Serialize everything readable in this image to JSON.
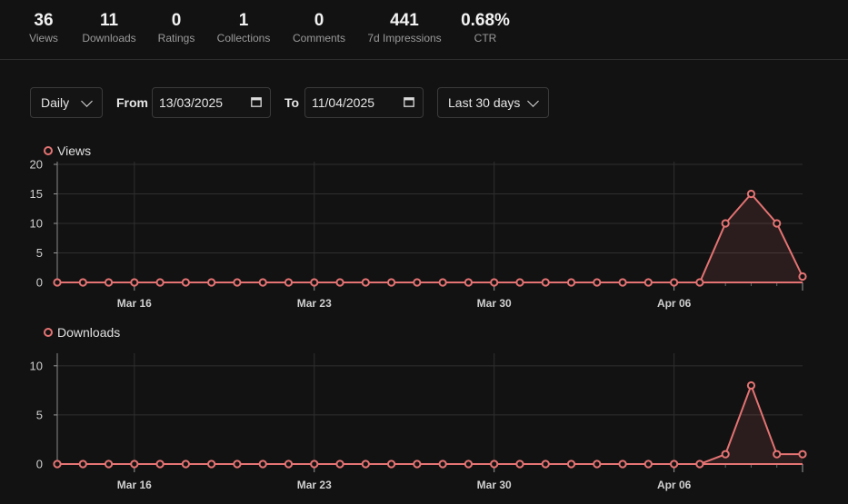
{
  "stats": [
    {
      "value": "36",
      "label": "Views"
    },
    {
      "value": "11",
      "label": "Downloads"
    },
    {
      "value": "0",
      "label": "Ratings"
    },
    {
      "value": "1",
      "label": "Collections"
    },
    {
      "value": "0",
      "label": "Comments"
    },
    {
      "value": "441",
      "label": "7d Impressions"
    },
    {
      "value": "0.68%",
      "label": "CTR"
    }
  ],
  "controls": {
    "interval": "Daily",
    "from_label": "From",
    "from_value": "13/03/2025",
    "to_label": "To",
    "to_value": "11/04/2025",
    "range": "Last 30 days"
  },
  "colors": {
    "series": "#e57373",
    "background": "#121212",
    "grid": "#2f2f2f"
  },
  "chart_data": [
    {
      "type": "area",
      "x_start": "2025-03-13",
      "x_end": "2025-04-11",
      "x_tick_labels": [
        "Mar 16",
        "Mar 23",
        "Mar 30",
        "Apr 06"
      ],
      "y_ticks": [
        0,
        5,
        10,
        15,
        20
      ],
      "ylim": [
        0,
        20
      ],
      "grid": true,
      "legend": "top-left",
      "series": [
        {
          "name": "Views",
          "values": [
            0,
            0,
            0,
            0,
            0,
            0,
            0,
            0,
            0,
            0,
            0,
            0,
            0,
            0,
            0,
            0,
            0,
            0,
            0,
            0,
            0,
            0,
            0,
            0,
            0,
            0,
            10,
            15,
            10,
            1
          ]
        }
      ]
    },
    {
      "type": "area",
      "x_start": "2025-03-13",
      "x_end": "2025-04-11",
      "x_tick_labels": [
        "Mar 16",
        "Mar 23",
        "Mar 30",
        "Apr 06"
      ],
      "y_ticks": [
        0,
        5,
        10
      ],
      "ylim": [
        0,
        11
      ],
      "grid": true,
      "legend": "top-left",
      "series": [
        {
          "name": "Downloads",
          "values": [
            0,
            0,
            0,
            0,
            0,
            0,
            0,
            0,
            0,
            0,
            0,
            0,
            0,
            0,
            0,
            0,
            0,
            0,
            0,
            0,
            0,
            0,
            0,
            0,
            0,
            0,
            1,
            8,
            1,
            1
          ]
        }
      ]
    }
  ]
}
